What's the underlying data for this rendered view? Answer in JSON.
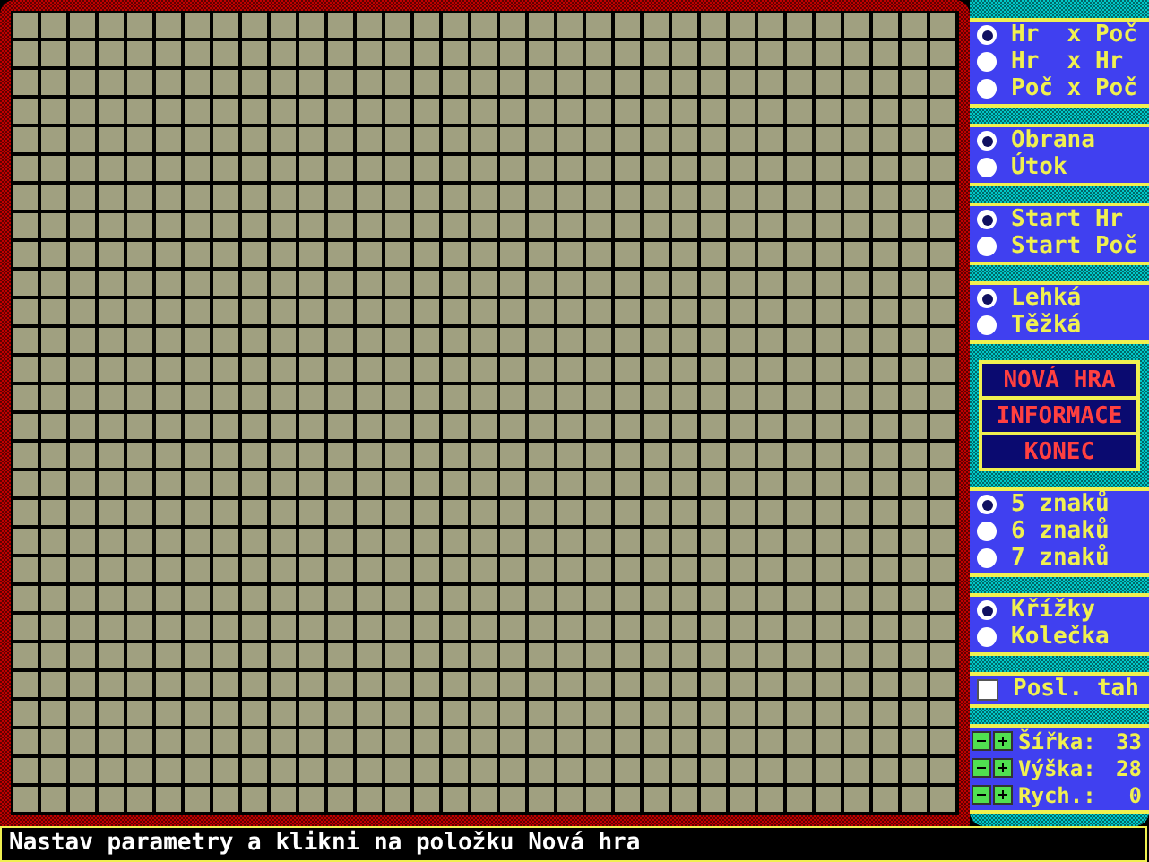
{
  "radio_groups": [
    {
      "options": [
        {
          "label": "Hr  x Poč",
          "selected": true
        },
        {
          "label": "Hr  x Hr",
          "selected": false
        },
        {
          "label": "Poč x Poč",
          "selected": false
        }
      ]
    },
    {
      "options": [
        {
          "label": "Obrana",
          "selected": true
        },
        {
          "label": "Útok",
          "selected": false
        }
      ]
    },
    {
      "options": [
        {
          "label": "Start Hr",
          "selected": true
        },
        {
          "label": "Start Poč",
          "selected": false
        }
      ]
    },
    {
      "options": [
        {
          "label": "Lehká",
          "selected": true
        },
        {
          "label": "Těžká",
          "selected": false
        }
      ]
    }
  ],
  "menu_buttons": [
    "NOVÁ HRA",
    "INFORMACE",
    "KONEC"
  ],
  "radio_groups_2": [
    {
      "options": [
        {
          "label": "5 znaků",
          "selected": true
        },
        {
          "label": "6 znaků",
          "selected": false
        },
        {
          "label": "7 znaků",
          "selected": false
        }
      ]
    },
    {
      "options": [
        {
          "label": "Křížky",
          "selected": true
        },
        {
          "label": "Kolečka",
          "selected": false
        }
      ]
    }
  ],
  "last_move": {
    "label": "Posl. tah",
    "checked": false
  },
  "steppers": [
    {
      "label": "Šířka:",
      "value": "33"
    },
    {
      "label": "Výška:",
      "value": "28"
    },
    {
      "label": "Rych.:",
      "value": "0"
    }
  ],
  "status_bar": "Nastav parametry a klikni na položku Nová hra"
}
